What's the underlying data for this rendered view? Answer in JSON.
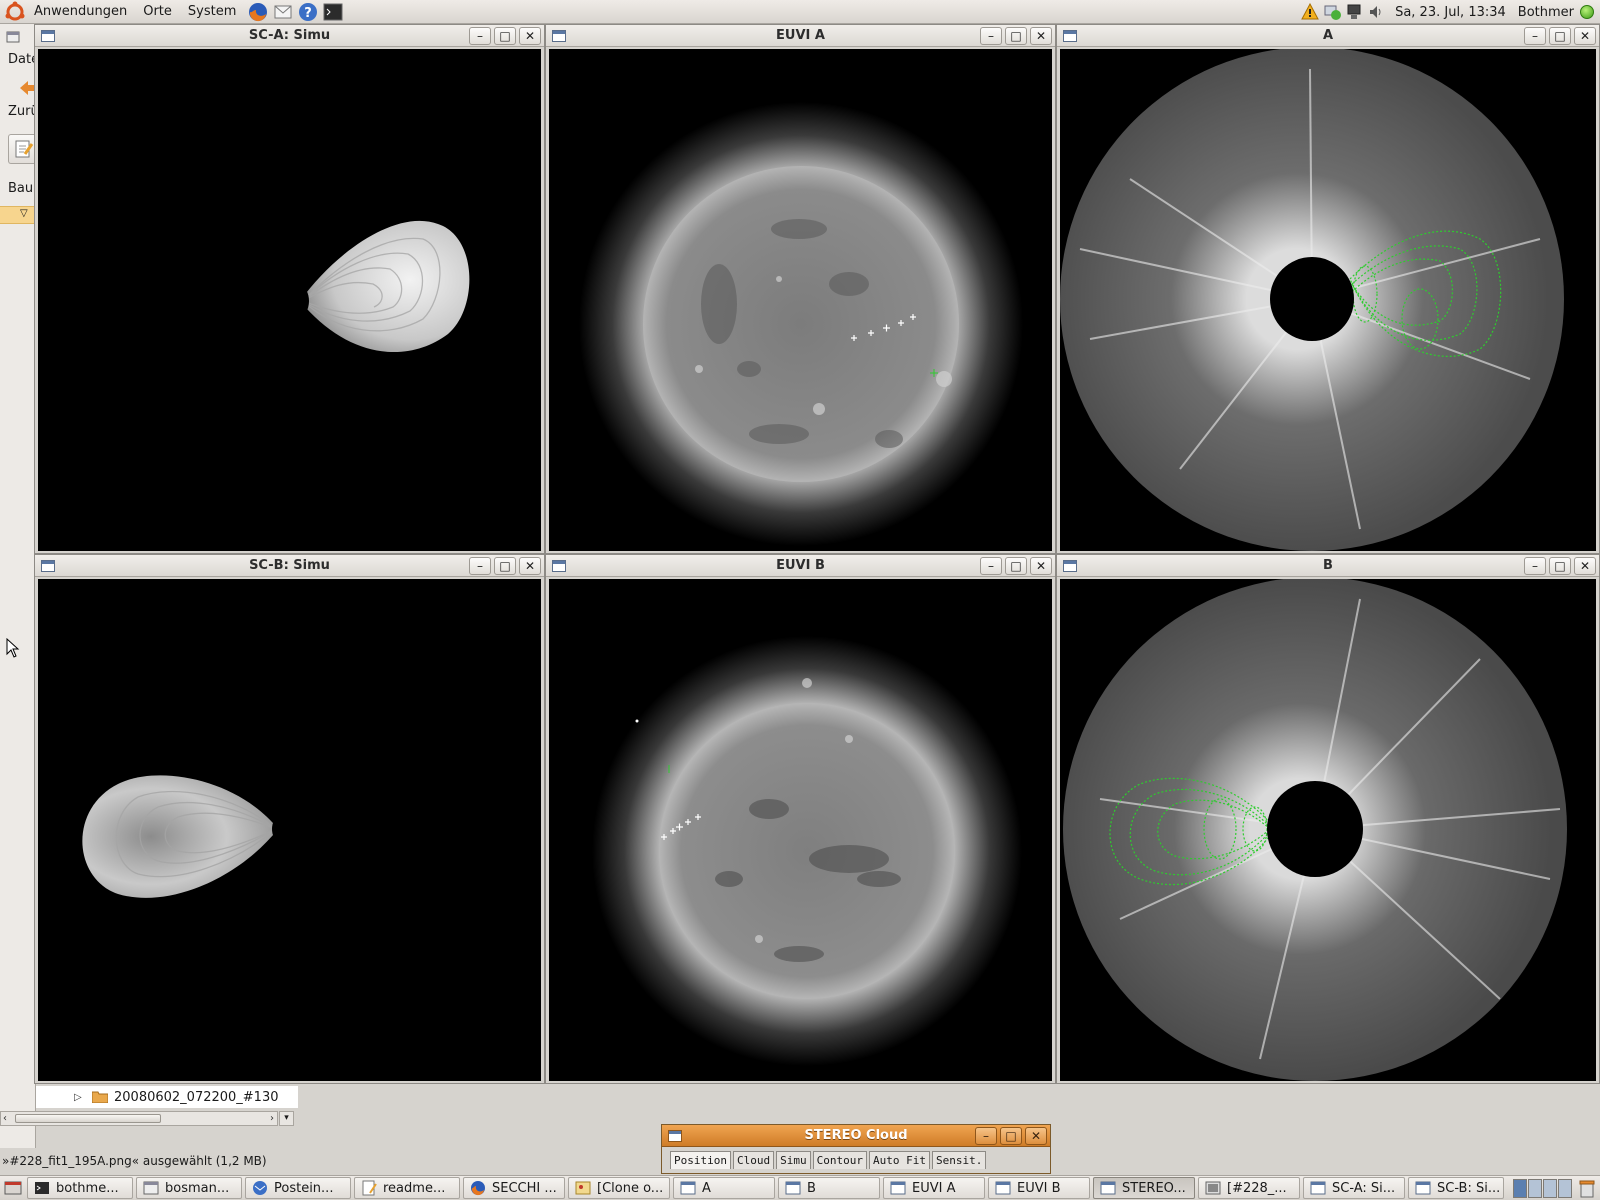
{
  "top_panel": {
    "menus": [
      "Anwendungen",
      "Orte",
      "System"
    ],
    "clock": "Sa, 23. Jul, 13:34",
    "user": "Bothmer"
  },
  "file_manager": {
    "menu_partial": "Date",
    "back_partial": "Zurü",
    "location_partial": "Bau"
  },
  "windows": {
    "sc_a": {
      "title": "SC-A: Simu"
    },
    "euvi_a": {
      "title": "EUVI A"
    },
    "cor_a": {
      "title": "A"
    },
    "sc_b": {
      "title": "SC-B: Simu"
    },
    "euvi_b": {
      "title": "EUVI B"
    },
    "cor_b": {
      "title": "B"
    }
  },
  "tree": {
    "folder": "20080602_072200_#130"
  },
  "status": {
    "text": "»#228_fit1_195A.png« ausgewählt (1,2 MB)"
  },
  "stereo_cloud": {
    "title": "STEREO Cloud",
    "tabs": [
      "Position",
      "Cloud",
      "Simu",
      "Contour",
      "Auto Fit",
      "Sensit."
    ]
  },
  "taskbar": {
    "tasks": [
      "bothme...",
      "bosman...",
      "Postein...",
      "readme...",
      "SECCHI ...",
      "[Clone o...",
      "A",
      "B",
      "EUVI A",
      "EUVI B",
      "STEREO...",
      "[#228_...",
      "SC-A: Si...",
      "SC-B: Si..."
    ],
    "active_index": 10
  },
  "colors": {
    "overlay": "#2ecc2e",
    "title_accent": "#e38b2f"
  }
}
